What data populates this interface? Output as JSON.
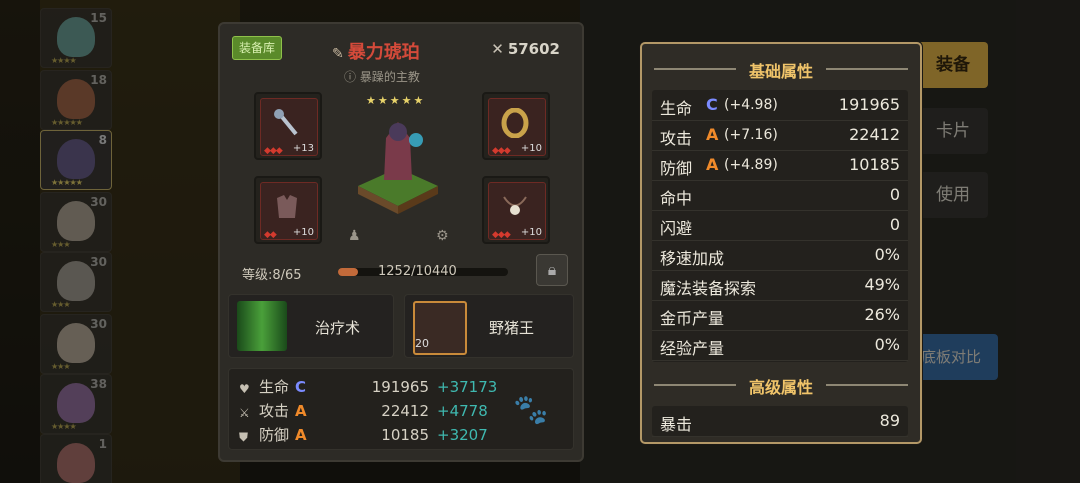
{
  "hero_list": {
    "levels": [
      "15",
      "18",
      "8",
      "30",
      "30",
      "30",
      "38",
      "1"
    ]
  },
  "equip_panel": {
    "armory_label": "装备库",
    "item_name": "暴力琥珀",
    "item_subtitle": "暴躁的主教",
    "power": "57602",
    "stars": "★★★★★",
    "slots": [
      {
        "icon": "staff-icon",
        "plus": "+13"
      },
      {
        "icon": "ring-icon",
        "plus": "+10"
      },
      {
        "icon": "armor-icon",
        "plus": "+10"
      },
      {
        "icon": "amulet-icon",
        "plus": "+10"
      }
    ],
    "level_label": "等级:8/65",
    "xp_text": "1252/10440",
    "xp_progress": 0.12,
    "skills": [
      {
        "name": "治疗术"
      },
      {
        "name": "野猪王",
        "badge": "20"
      }
    ],
    "stats": [
      {
        "label": "生命",
        "grade": "C",
        "value": "191965",
        "delta": "+37173"
      },
      {
        "label": "攻击",
        "grade": "A",
        "value": "22412",
        "delta": "+4778"
      },
      {
        "label": "防御",
        "grade": "A",
        "value": "10185",
        "delta": "+3207"
      }
    ]
  },
  "right_nav": {
    "equip": "装备",
    "card": "卡片",
    "use": "使用",
    "compare": "底板对比"
  },
  "popup": {
    "basic_title": "基础属性",
    "advanced_title": "高级属性",
    "basic_attrs": [
      {
        "label": "生命",
        "grade": "C",
        "grade_color": "#7b8bff",
        "growth": "(+4.98)",
        "value": "191965"
      },
      {
        "label": "攻击",
        "grade": "A",
        "grade_color": "#f08a2a",
        "growth": "(+7.16)",
        "value": "22412"
      },
      {
        "label": "防御",
        "grade": "A",
        "grade_color": "#f08a2a",
        "growth": "(+4.89)",
        "value": "10185"
      },
      {
        "label": "命中",
        "value": "0"
      },
      {
        "label": "闪避",
        "value": "0"
      },
      {
        "label": "移速加成",
        "value": "0%"
      },
      {
        "label": "魔法装备探索",
        "value": "49%"
      },
      {
        "label": "金币产量",
        "value": "26%"
      },
      {
        "label": "经验产量",
        "value": "0%"
      }
    ],
    "advanced_attrs": [
      {
        "label": "暴击",
        "value": "89"
      }
    ]
  }
}
